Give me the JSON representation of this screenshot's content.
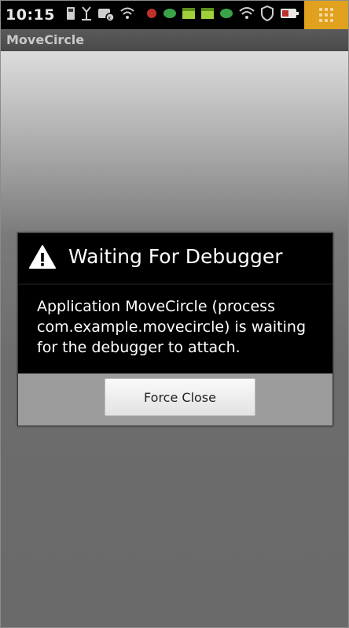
{
  "status_bar": {
    "time": "10:15",
    "icons_left": [
      "sd-card-icon",
      "usb-debug-icon",
      "missed-call-icon",
      "wifi-icon"
    ],
    "icons_right": [
      "notification-dot-icon",
      "chat-icon",
      "calendar-icon",
      "calendar-icon",
      "chat-icon",
      "wifi-signal-icon",
      "shield-icon",
      "battery-icon"
    ],
    "menu_button_color": "#e0a11e"
  },
  "app": {
    "title": "MoveCircle"
  },
  "dialog": {
    "icon": "warning-icon",
    "title": "Waiting For Debugger",
    "message": "Application MoveCircle (process com.example.movecircle) is waiting for the debugger to attach.",
    "button_label": "Force Close"
  }
}
